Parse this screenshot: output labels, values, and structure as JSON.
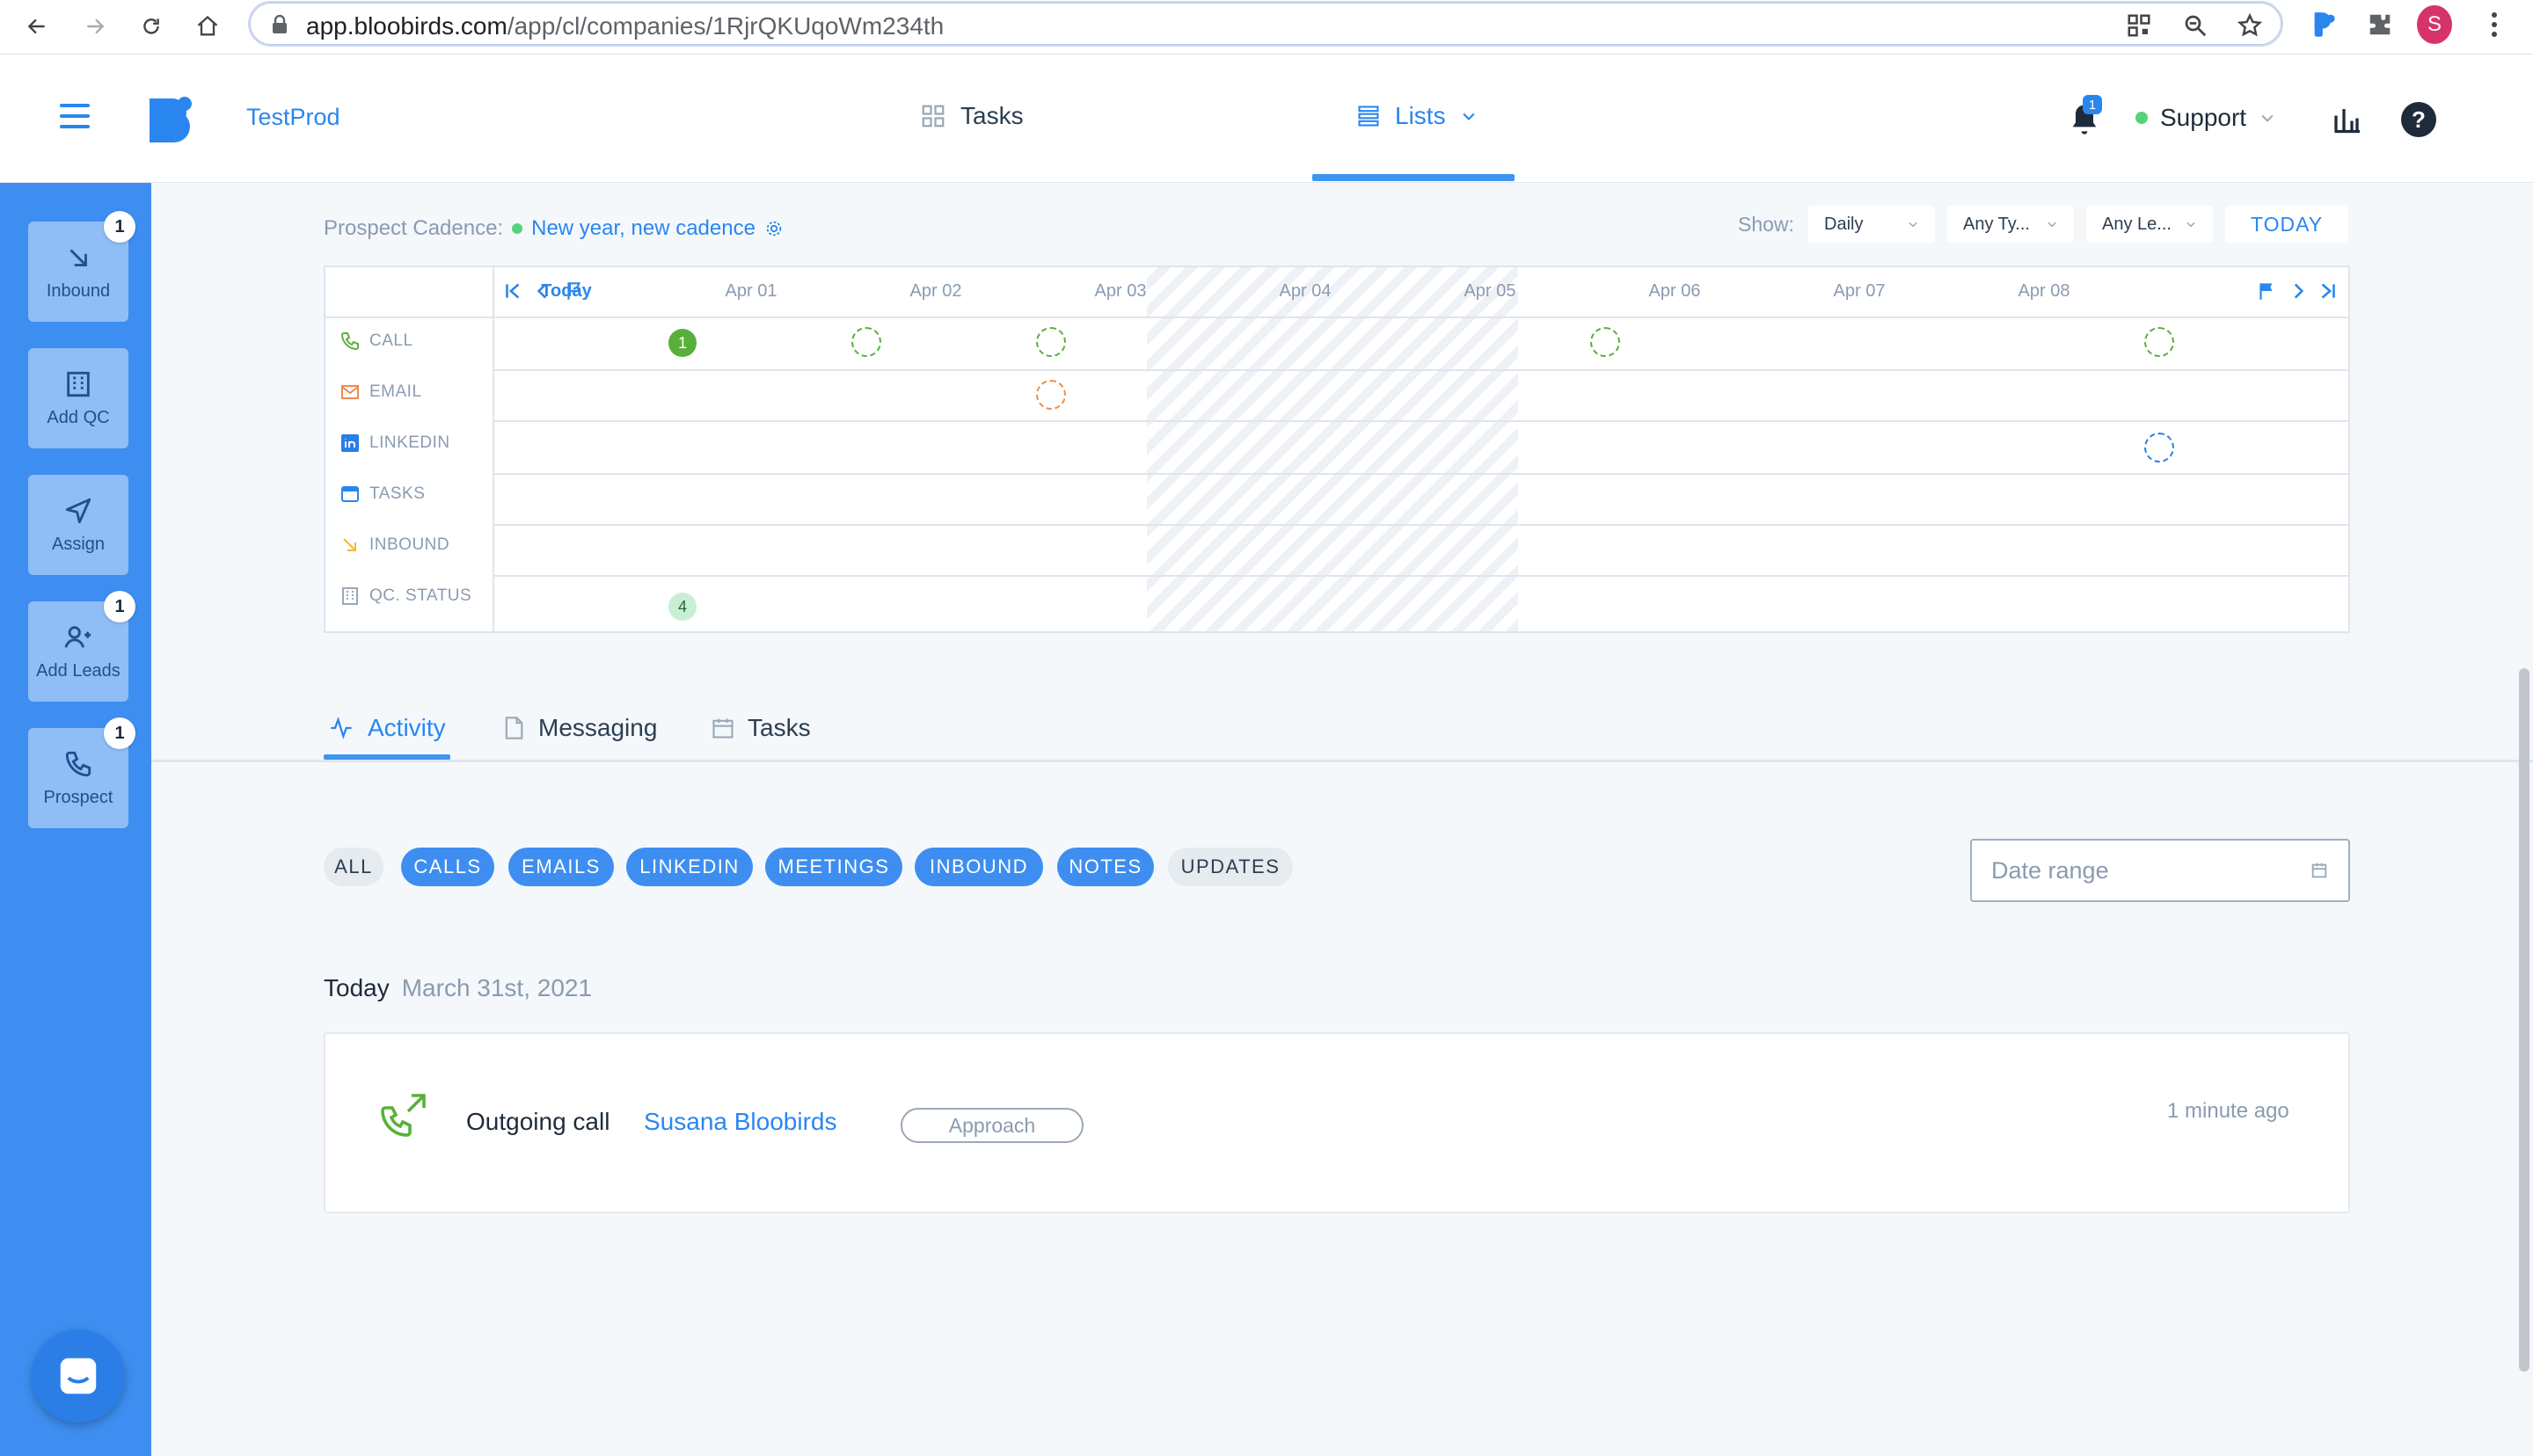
{
  "browser": {
    "url_host": "app.bloobirds.com",
    "url_path": "/app/cl/companies/1RjrQKUqoWm234th",
    "profile_initial": "S"
  },
  "header": {
    "brand": "TestProd",
    "tasks_label": "Tasks",
    "lists_label": "Lists",
    "notification_count": "1",
    "support_label": "Support",
    "help_label": "?"
  },
  "sidebar": {
    "items": [
      {
        "label": "Inbound",
        "badge": "1",
        "icon": "inbound-arrow-icon"
      },
      {
        "label": "Add QC",
        "badge": "",
        "icon": "building-icon"
      },
      {
        "label": "Assign",
        "badge": "",
        "icon": "send-icon"
      },
      {
        "label": "Add Leads",
        "badge": "1",
        "icon": "add-user-icon"
      },
      {
        "label": "Prospect",
        "badge": "1",
        "icon": "phone-icon"
      }
    ]
  },
  "cadence": {
    "label": "Prospect Cadence:",
    "name": "New year, new cadence",
    "show_label": "Show:",
    "filters": [
      "Daily",
      "Any Ty...",
      "Any Le..."
    ],
    "today_button": "TODAY",
    "columns": [
      "Today",
      "Apr 01",
      "Apr 02",
      "Apr 03",
      "Apr 04",
      "Apr 05",
      "Apr 06",
      "Apr 07",
      "Apr 08"
    ],
    "rows": [
      "CALL",
      "EMAIL",
      "LINKEDIN",
      "TASKS",
      "INBOUND",
      "QC. STATUS"
    ],
    "call_today_count": "1",
    "qc_today_count": "4"
  },
  "tabs": {
    "activity": "Activity",
    "messaging": "Messaging",
    "tasks": "Tasks"
  },
  "filters": {
    "chips": [
      "ALL",
      "CALLS",
      "EMAILS",
      "LINKEDIN",
      "MEETINGS",
      "INBOUND",
      "NOTES",
      "UPDATES"
    ],
    "date_range_placeholder": "Date range"
  },
  "feed": {
    "day_label": "Today",
    "day_date": "March 31st, 2021",
    "items": [
      {
        "type": "Outgoing call",
        "name": "Susana Bloobirds",
        "tag": "Approach",
        "time": "1 minute ago"
      }
    ]
  },
  "colors": {
    "primary": "#2a86ef",
    "sidebar": "#3d8ef0",
    "call_green": "#58b03a",
    "email_orange": "#f08a4b",
    "linkedin_blue": "#2a7ee6"
  }
}
